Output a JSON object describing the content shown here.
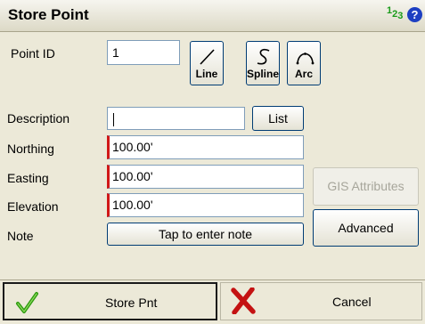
{
  "window": {
    "title": "Store Point",
    "num_indicator": [
      "1",
      "2",
      "3"
    ]
  },
  "fields": {
    "point_id": {
      "label": "Point ID",
      "value": "1"
    },
    "description": {
      "label": "Description",
      "value": ""
    },
    "northing": {
      "label": "Northing",
      "value": "100.00'"
    },
    "easting": {
      "label": "Easting",
      "value": "100.00'"
    },
    "elevation": {
      "label": "Elevation",
      "value": "100.00'"
    },
    "note": {
      "label": "Note",
      "button": "Tap to enter note"
    }
  },
  "geometry_buttons": {
    "line": "Line",
    "spline": "Spline",
    "arc": "Arc"
  },
  "buttons": {
    "list": "List",
    "gis_attributes": "GIS Attributes",
    "advanced": "Advanced",
    "store": "Store Pnt",
    "cancel": "Cancel"
  },
  "icons": {
    "help": "help-icon",
    "line": "line-icon",
    "spline": "spline-icon",
    "arc": "arc-icon",
    "store": "checkmark-icon",
    "cancel": "red-x-icon"
  },
  "colors": {
    "required_marker": "#d01818",
    "check": "#2e9b10",
    "cancel_x": "#c41212"
  }
}
